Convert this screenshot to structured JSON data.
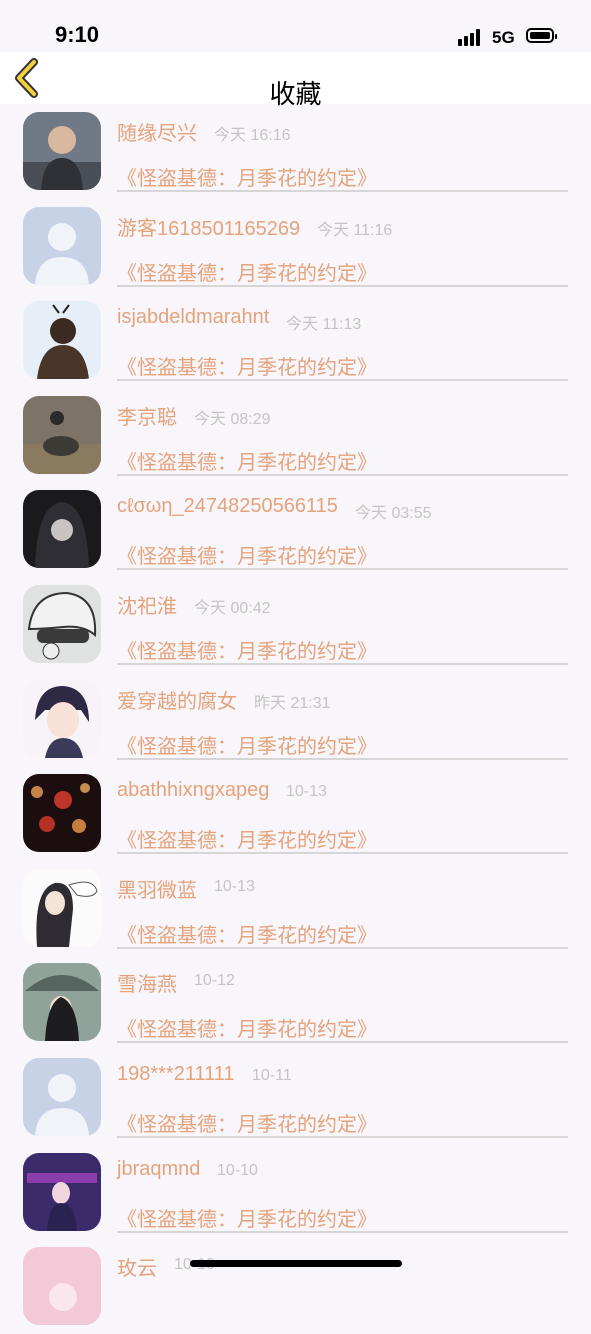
{
  "status": {
    "time": "9:10",
    "network": "5G"
  },
  "nav": {
    "title": "收藏"
  },
  "items": [
    {
      "user": "随缘尽兴",
      "time": "今天 16:16",
      "work": "《怪盗基德：月季花的约定》",
      "avatar": "photo-avatar-gray"
    },
    {
      "user": "游客1618501165269",
      "time": "今天 11:16",
      "work": "《怪盗基德：月季花的约定》",
      "avatar": "default-avatar"
    },
    {
      "user": "isjabdeldmarahnt",
      "time": "今天 11:13",
      "work": "《怪盗基德：月季花的约定》",
      "avatar": "photo-avatar-blue"
    },
    {
      "user": "李京聪",
      "time": "今天 08:29",
      "work": "《怪盗基德：月季花的约定》",
      "avatar": "photo-avatar-horse"
    },
    {
      "user": "cℓσωη_24748250566115",
      "time": "今天 03:55",
      "work": "《怪盗基德：月季花的约定》",
      "avatar": "photo-avatar-dark"
    },
    {
      "user": "沈祀淮",
      "time": "今天 00:42",
      "work": "《怪盗基德：月季花的约定》",
      "avatar": "photo-avatar-anime-helmet"
    },
    {
      "user": "爱穿越的腐女",
      "time": "昨天 21:31",
      "work": "《怪盗基德：月季花的约定》",
      "avatar": "photo-avatar-anime-boy"
    },
    {
      "user": "abathhixngxapeg",
      "time": "10-13",
      "work": "《怪盗基德：月季花的约定》",
      "avatar": "photo-avatar-bokeh"
    },
    {
      "user": "黑羽微蓝",
      "time": "10-13",
      "work": "《怪盗基德：月季花的约定》",
      "avatar": "photo-avatar-anime-girl"
    },
    {
      "user": "雪海燕",
      "time": "10-12",
      "work": "《怪盗基德：月季花的约定》",
      "avatar": "photo-avatar-umbrella"
    },
    {
      "user": "198***211111",
      "time": "10-11",
      "work": "《怪盗基德：月季花的约定》",
      "avatar": "default-avatar"
    },
    {
      "user": "jbraqmnd",
      "time": "10-10",
      "work": "《怪盗基德：月季花的约定》",
      "avatar": "photo-avatar-purple"
    },
    {
      "user": "玫云",
      "time": "10-10",
      "work": "",
      "avatar": "photo-avatar-pink"
    }
  ]
}
